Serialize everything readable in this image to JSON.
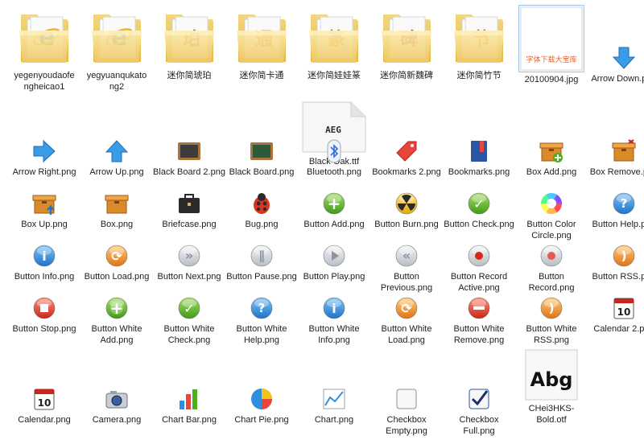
{
  "window": {
    "type": "file-explorer-large-icons"
  },
  "items": [
    {
      "label": "yegenyoudaofe ngheicao1",
      "icon": "folder-ie-icon",
      "kind": "folder",
      "glyph": "e",
      "glyphColor": "#1a73d1"
    },
    {
      "label": "yegyuanqukato ng2",
      "icon": "folder-ie-icon",
      "kind": "folder",
      "glyph": "e",
      "glyphColor": "#1a73d1"
    },
    {
      "label": "迷你简琥珀",
      "icon": "folder-font-icon",
      "kind": "folder",
      "glyph": "珀",
      "glyphColor": "#d2691e"
    },
    {
      "label": "迷你简卡通",
      "icon": "folder-font-icon",
      "kind": "folder",
      "glyph": "通",
      "glyphColor": "#e07a1a"
    },
    {
      "label": "迷你简娃娃篆",
      "icon": "folder-font-icon",
      "kind": "folder",
      "glyph": "篆",
      "glyphColor": "#e07a1a"
    },
    {
      "label": "迷你简新魏碑",
      "icon": "folder-font-icon",
      "kind": "folder",
      "glyph": "碑",
      "glyphColor": "#c0392b"
    },
    {
      "label": "迷你简竹节",
      "icon": "folder-font-icon",
      "kind": "folder",
      "glyph": "节",
      "glyphColor": "#e07a1a"
    },
    {
      "label": "20100904.jpg",
      "icon": "jpg-thumbnail-icon",
      "kind": "thumb",
      "thumbText": "字体下载大宝库",
      "selected": true
    },
    {
      "label": "Arrow Down.png",
      "icon": "arrow-down-icon",
      "kind": "png"
    },
    {
      "label": "Black Oak.ttf",
      "icon": "font-file-icon",
      "kind": "font",
      "thumbText": "AEG"
    },
    {
      "label": "Arrow Right.png",
      "icon": "arrow-right-icon",
      "kind": "png"
    },
    {
      "label": "Arrow Up.png",
      "icon": "arrow-up-icon",
      "kind": "png"
    },
    {
      "label": "Black Board 2.png",
      "icon": "blackboard-brown-icon",
      "kind": "png"
    },
    {
      "label": "Black Board.png",
      "icon": "blackboard-green-icon",
      "kind": "png"
    },
    {
      "label": "Bluetooth.png",
      "icon": "bluetooth-icon",
      "kind": "png"
    },
    {
      "label": "Bookmarks 2.png",
      "icon": "tag-icon",
      "kind": "png"
    },
    {
      "label": "Bookmarks.png",
      "icon": "book-icon",
      "kind": "png"
    },
    {
      "label": "Box Add.png",
      "icon": "box-add-icon",
      "kind": "png"
    },
    {
      "label": "Box Remove.png",
      "icon": "box-remove-icon",
      "kind": "png"
    },
    {
      "label": "Box Up.png",
      "icon": "box-up-icon",
      "kind": "png"
    },
    {
      "label": "Box.png",
      "icon": "box-icon",
      "kind": "png"
    },
    {
      "label": "Briefcase.png",
      "icon": "briefcase-icon",
      "kind": "png"
    },
    {
      "label": "Bug.png",
      "icon": "bug-icon",
      "kind": "png"
    },
    {
      "label": "Button Add.png",
      "icon": "button-add-icon",
      "kind": "png"
    },
    {
      "label": "Button Burn.png",
      "icon": "button-burn-icon",
      "kind": "png"
    },
    {
      "label": "Button Check.png",
      "icon": "button-check-icon",
      "kind": "png"
    },
    {
      "label": "Button Color Circle.png",
      "icon": "color-circle-icon",
      "kind": "png"
    },
    {
      "label": "Button Help.png",
      "icon": "button-help-icon",
      "kind": "png"
    },
    {
      "label": "Button Info.png",
      "icon": "button-info-icon",
      "kind": "png"
    },
    {
      "label": "Button Load.png",
      "icon": "button-load-icon",
      "kind": "png"
    },
    {
      "label": "Button Next.png",
      "icon": "button-next-icon",
      "kind": "png"
    },
    {
      "label": "Button Pause.png",
      "icon": "button-pause-icon",
      "kind": "png"
    },
    {
      "label": "Button Play.png",
      "icon": "button-play-icon",
      "kind": "png"
    },
    {
      "label": "Button Previous.png",
      "icon": "button-previous-icon",
      "kind": "png"
    },
    {
      "label": "Button Record Active.png",
      "icon": "button-record-active-icon",
      "kind": "png"
    },
    {
      "label": "Button Record.png",
      "icon": "button-record-icon",
      "kind": "png"
    },
    {
      "label": "Button RSS.png",
      "icon": "button-rss-icon",
      "kind": "png"
    },
    {
      "label": "Button Stop.png",
      "icon": "button-stop-icon",
      "kind": "png"
    },
    {
      "label": "Button White Add.png",
      "icon": "button-white-add-icon",
      "kind": "png"
    },
    {
      "label": "Button White Check.png",
      "icon": "button-white-check-icon",
      "kind": "png"
    },
    {
      "label": "Button White Help.png",
      "icon": "button-white-help-icon",
      "kind": "png"
    },
    {
      "label": "Button White Info.png",
      "icon": "button-white-info-icon",
      "kind": "png"
    },
    {
      "label": "Button White Load.png",
      "icon": "button-white-load-icon",
      "kind": "png"
    },
    {
      "label": "Button White Remove.png",
      "icon": "button-white-remove-icon",
      "kind": "png"
    },
    {
      "label": "Button White RSS.png",
      "icon": "button-white-rss-icon",
      "kind": "png"
    },
    {
      "label": "Calendar 2.png",
      "icon": "calendar-icon",
      "kind": "png",
      "thumbText": "10"
    },
    {
      "label": "Calendar.png",
      "icon": "calendar-icon",
      "kind": "png",
      "thumbText": "10"
    },
    {
      "label": "Camera.png",
      "icon": "camera-icon",
      "kind": "png"
    },
    {
      "label": "Chart Bar.png",
      "icon": "chart-bar-icon",
      "kind": "png"
    },
    {
      "label": "Chart Pie.png",
      "icon": "chart-pie-icon",
      "kind": "png"
    },
    {
      "label": "Chart.png",
      "icon": "chart-line-icon",
      "kind": "png"
    },
    {
      "label": "Checkbox Empty.png",
      "icon": "checkbox-empty-icon",
      "kind": "png"
    },
    {
      "label": "Checkbox Full.png",
      "icon": "checkbox-full-icon",
      "kind": "png"
    },
    {
      "label": "CHei3HKS-Bold.otf",
      "icon": "font-file-icon",
      "kind": "fontbig",
      "thumbText": "Abg"
    }
  ]
}
